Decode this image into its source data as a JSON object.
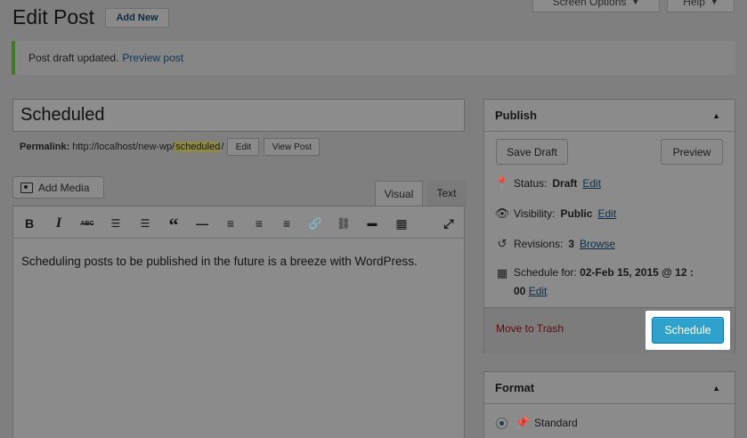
{
  "header": {
    "title": "Edit Post",
    "add_new": "Add New",
    "screen_options": "Screen Options",
    "help": "Help"
  },
  "notice": {
    "text": "Post draft updated.",
    "link": "Preview post"
  },
  "post": {
    "title": "Scheduled",
    "permalink_label": "Permalink:",
    "permalink_base": "http://localhost/new-wp/",
    "permalink_slug": "scheduled",
    "permalink_end": "/",
    "edit_button": "Edit",
    "view_post_button": "View Post"
  },
  "editor": {
    "add_media": "Add Media",
    "tab_visual": "Visual",
    "tab_text": "Text",
    "toolbar": [
      {
        "name": "bold-icon",
        "glyph": "B"
      },
      {
        "name": "italic-icon",
        "glyph": "I"
      },
      {
        "name": "strikethrough-icon",
        "glyph": "ABC"
      },
      {
        "name": "bullet-list-icon",
        "glyph": "☰"
      },
      {
        "name": "numbered-list-icon",
        "glyph": "☰"
      },
      {
        "name": "blockquote-icon",
        "glyph": "“"
      },
      {
        "name": "horizontal-line-icon",
        "glyph": "—"
      },
      {
        "name": "align-left-icon",
        "glyph": "≡"
      },
      {
        "name": "align-center-icon",
        "glyph": "≡"
      },
      {
        "name": "align-right-icon",
        "glyph": "≡"
      },
      {
        "name": "insert-link-icon",
        "glyph": "🔗"
      },
      {
        "name": "remove-link-icon",
        "glyph": "⛓"
      },
      {
        "name": "read-more-icon",
        "glyph": "▬"
      },
      {
        "name": "toolbar-toggle-icon",
        "glyph": "▦"
      },
      {
        "name": "fullscreen-icon",
        "glyph": "⤢"
      }
    ],
    "content": "Scheduling posts to be published in the future is a breeze with WordPress."
  },
  "publish": {
    "title": "Publish",
    "save_draft": "Save Draft",
    "preview": "Preview",
    "status_label": "Status:",
    "status_value": "Draft",
    "visibility_label": "Visibility:",
    "visibility_value": "Public",
    "revisions_label": "Revisions:",
    "revisions_value": "3",
    "browse": "Browse",
    "schedule_label": "Schedule for:",
    "schedule_value_line1": "02-Feb 15, 2015 @ 12 :",
    "schedule_value_line2": "00",
    "edit": "Edit",
    "move_to_trash": "Move to Trash",
    "schedule_button": "Schedule"
  },
  "format": {
    "title": "Format",
    "standard": "Standard"
  },
  "colors": {
    "schedule_button": "#2ea2cc",
    "notice_border": "#3f7a24",
    "trash_link": "#5e0b0b"
  }
}
